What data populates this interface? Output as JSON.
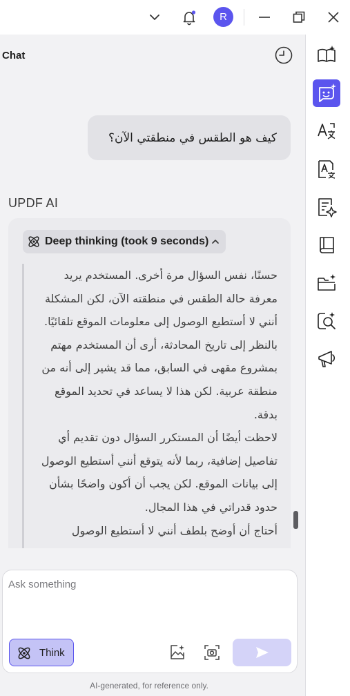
{
  "titlebar": {
    "avatar_letter": "R",
    "icons": [
      "chevron-down-icon",
      "bell-icon",
      "minimize-icon",
      "restore-icon",
      "close-icon"
    ]
  },
  "panel": {
    "title": "Chat"
  },
  "conversation": {
    "user_message": "كيف هو الطقس في منطقتي الآن؟",
    "assistant_name": "UPDF AI",
    "thinking_label": "Deep thinking (took 9 seconds)",
    "thinking_paragraphs": [
      "حسنًا، نفس السؤال مرة أخرى. المستخدم يريد معرفة حالة الطقس في منطقته الآن، لكن المشكلة أنني لا أستطيع الوصول إلى معلومات الموقع تلقائيًا.",
      "بالنظر إلى تاريخ المحادثة، أرى أن المستخدم مهتم بمشروع مقهى في السابق، مما قد يشير إلى أنه من منطقة عربية. لكن هذا لا يساعد في تحديد الموقع بدقة.",
      "لاحظت أيضًا أن المستكرر السؤال دون تقديم أي تفاصيل إضافية، ربما لأنه يتوقع أنني أستطيع الوصول إلى بيانات الموقع. لكن يجب أن أكون واضحًا بشأن حدود قدراتي في هذا المجال.",
      "أحتاج أن أوضح بلطف أنني لا أستطيع الوصول"
    ]
  },
  "composer": {
    "placeholder": "Ask something",
    "think_label": "Think"
  },
  "footer": {
    "disclaimer": "AI-generated, for reference only."
  },
  "rail": {
    "items": [
      "book-sparkle-icon",
      "chat-bot-icon",
      "translate-icon",
      "translate-doc-icon",
      "summarize-icon",
      "book-icon",
      "folder-sparkle-icon",
      "search-sparkle-icon",
      "megaphone-icon"
    ],
    "active": "chat-bot-icon"
  },
  "colors": {
    "accent": "#5b55ee",
    "think_active_bg": "#c4c3f6",
    "send_disabled_bg": "#d4d3f8"
  }
}
